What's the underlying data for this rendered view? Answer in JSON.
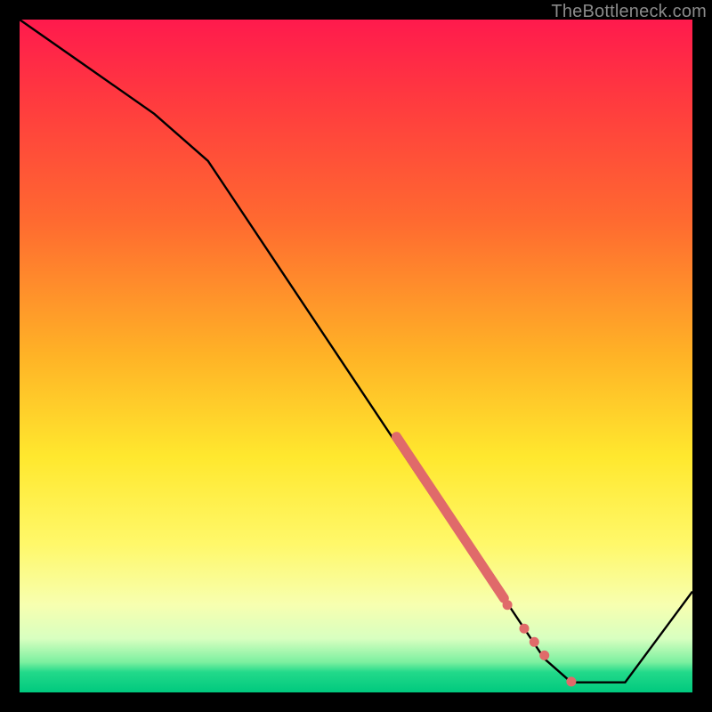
{
  "watermark": "TheBottleneck.com",
  "colors": {
    "frame": "#000000",
    "curve": "#000000",
    "dots": "#e06a6a",
    "gradient_top": "#ff1a4d",
    "gradient_bottom": "#00c97e"
  },
  "chart_data": {
    "type": "line",
    "title": "",
    "xlabel": "",
    "ylabel": "",
    "xlim": [
      0,
      100
    ],
    "ylim": [
      0,
      100
    ],
    "note": "No axis tick labels visible; x/y in percent of plot area. y=100 is top (red), y=0 is bottom (green).",
    "series": [
      {
        "name": "curve",
        "x": [
          0,
          10,
          20,
          28,
          40,
          50,
          60,
          70,
          78,
          82,
          90,
          100
        ],
        "y": [
          100,
          93,
          86,
          79,
          61,
          46,
          31,
          17,
          5,
          1.5,
          1.5,
          15
        ]
      }
    ],
    "highlight_segment": {
      "name": "thick-pink-band",
      "x": [
        56,
        72
      ],
      "y": [
        38,
        14
      ]
    },
    "dots": [
      {
        "x": 72.5,
        "y": 13
      },
      {
        "x": 75,
        "y": 9.5
      },
      {
        "x": 76.5,
        "y": 7.5
      },
      {
        "x": 78,
        "y": 5.5
      },
      {
        "x": 82,
        "y": 1.6
      }
    ]
  }
}
